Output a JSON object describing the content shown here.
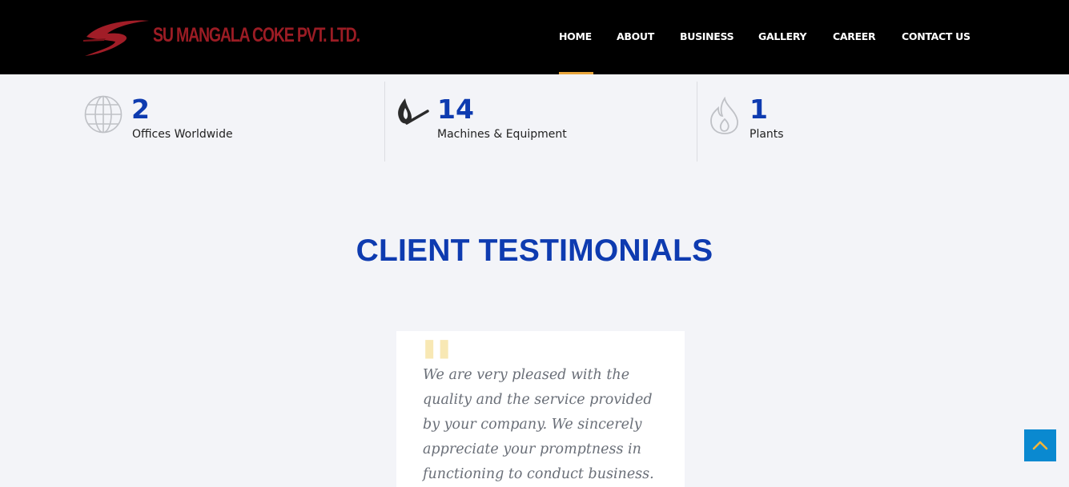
{
  "brand": {
    "name": "SU MANGALA COKE PVT. LTD.",
    "logo_icon": "red-swoosh-logo"
  },
  "nav": {
    "items": [
      {
        "label": "HOME",
        "active": true
      },
      {
        "label": "ABOUT"
      },
      {
        "label": "BUSINESS"
      },
      {
        "label": "GALLERY"
      },
      {
        "label": "CAREER"
      },
      {
        "label": "CONTACT US"
      }
    ],
    "active_color": "#e8a53c"
  },
  "stats": [
    {
      "value": "2",
      "label": "Offices Worldwide",
      "icon": "globe-icon"
    },
    {
      "value": "14",
      "label": "Machines & Equipment",
      "icon": "match-icon"
    },
    {
      "value": "1",
      "label": "Plants",
      "icon": "flame-icon"
    }
  ],
  "testimonials": {
    "title": "CLIENT TESTIMONIALS",
    "quote": "We are very pleased with the quality and the service provided by your company. We sincerely appreciate your promptness in functioning to conduct business."
  },
  "colors": {
    "accent_blue": "#0e3bb0",
    "brand_red": "#9b1c24",
    "scroll_button": "#0a89d0"
  },
  "scroll_top": {
    "icon": "chevron-up-icon"
  }
}
